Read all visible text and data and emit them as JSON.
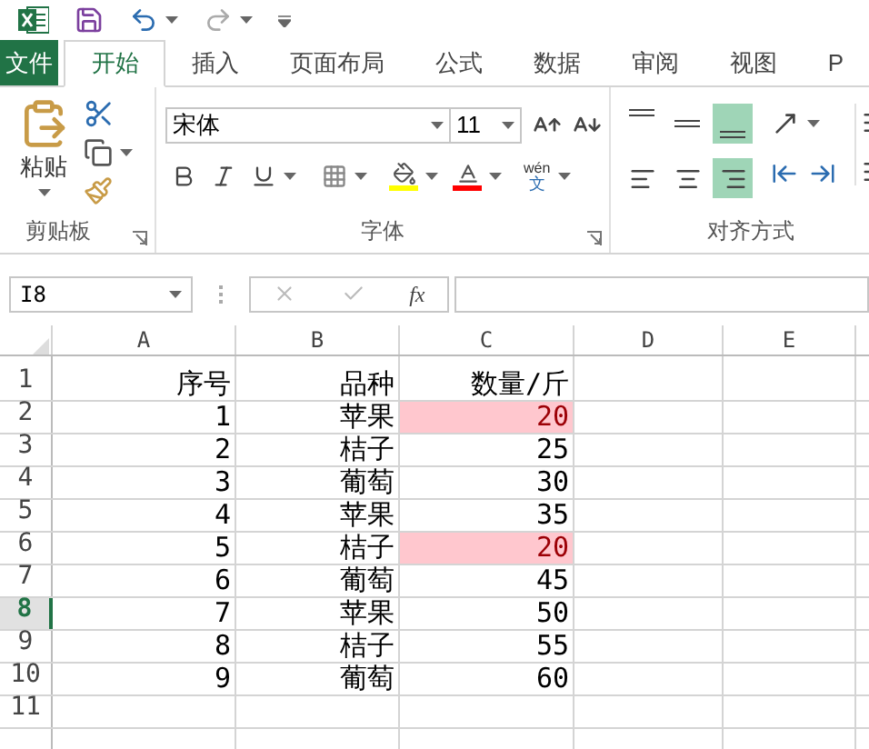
{
  "tabs": [
    {
      "label": "文件",
      "kind": "file",
      "selected": false
    },
    {
      "label": "开始",
      "kind": "tab",
      "selected": true
    },
    {
      "label": "插入",
      "kind": "tab",
      "selected": false
    },
    {
      "label": "页面布局",
      "kind": "tab",
      "selected": false
    },
    {
      "label": "公式",
      "kind": "tab",
      "selected": false
    },
    {
      "label": "数据",
      "kind": "tab",
      "selected": false
    },
    {
      "label": "审阅",
      "kind": "tab",
      "selected": false
    },
    {
      "label": "视图",
      "kind": "tab",
      "selected": false
    },
    {
      "label": "P",
      "kind": "tab",
      "selected": false
    }
  ],
  "ribbon": {
    "clipboard": {
      "label": "剪贴板",
      "paste": "粘贴"
    },
    "font": {
      "label": "字体",
      "font_name": "宋体",
      "font_size": "11",
      "phonetic_top": "wén",
      "phonetic_bottom": "文"
    },
    "alignment": {
      "label": "对齐方式",
      "vertical": [
        {
          "kind": "top",
          "selected": false
        },
        {
          "kind": "middle",
          "selected": false
        },
        {
          "kind": "bottom",
          "selected": true
        }
      ],
      "horizontal": [
        {
          "kind": "left",
          "selected": false
        },
        {
          "kind": "center",
          "selected": false
        },
        {
          "kind": "right",
          "selected": true
        }
      ]
    }
  },
  "formula_bar": {
    "name_box": "I8",
    "function_label": "fx"
  },
  "sheet": {
    "columns": [
      "A",
      "B",
      "C",
      "D",
      "E"
    ],
    "rows": [
      {
        "number": "1",
        "selected": false,
        "values": [
          "序号",
          "品种",
          "数量/斤"
        ],
        "flagged": false
      },
      {
        "number": "2",
        "selected": false,
        "values": [
          "1",
          "苹果",
          "20"
        ],
        "flagged": true
      },
      {
        "number": "3",
        "selected": false,
        "values": [
          "2",
          "桔子",
          "25"
        ],
        "flagged": false
      },
      {
        "number": "4",
        "selected": false,
        "values": [
          "3",
          "葡萄",
          "30"
        ],
        "flagged": false
      },
      {
        "number": "5",
        "selected": false,
        "values": [
          "4",
          "苹果",
          "35"
        ],
        "flagged": false
      },
      {
        "number": "6",
        "selected": false,
        "values": [
          "5",
          "桔子",
          "20"
        ],
        "flagged": true
      },
      {
        "number": "7",
        "selected": false,
        "values": [
          "6",
          "葡萄",
          "45"
        ],
        "flagged": false
      },
      {
        "number": "8",
        "selected": true,
        "values": [
          "7",
          "苹果",
          "50"
        ],
        "flagged": false
      },
      {
        "number": "9",
        "selected": false,
        "values": [
          "8",
          "桔子",
          "55"
        ],
        "flagged": false
      },
      {
        "number": "10",
        "selected": false,
        "values": [
          "9",
          "葡萄",
          "60"
        ],
        "flagged": false
      },
      {
        "number": "11",
        "selected": false,
        "values": [],
        "flagged": false
      }
    ]
  }
}
